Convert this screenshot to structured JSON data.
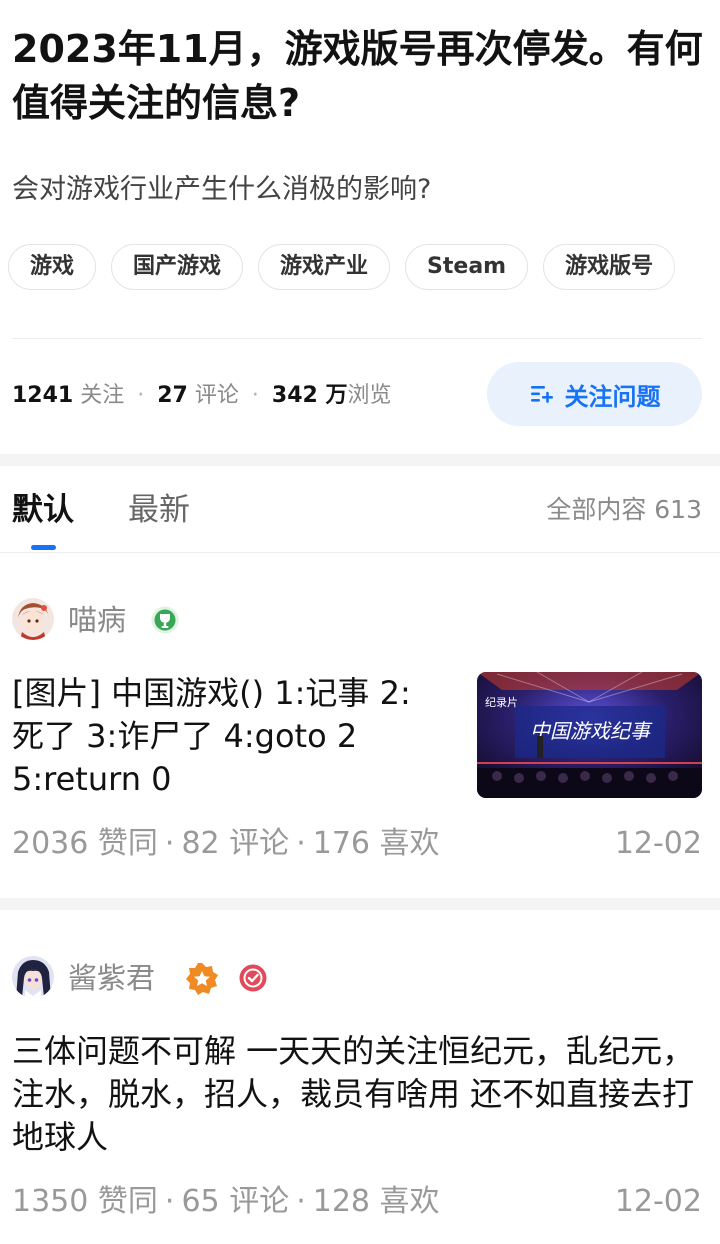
{
  "question": {
    "title": "2023年11月，游戏版号再次停发。有何值得关注的信息?",
    "subtitle": "会对游戏行业产生什么消极的影响?",
    "tags": [
      "游戏",
      "国产游戏",
      "游戏产业",
      "Steam",
      "游戏版号"
    ],
    "stats": {
      "follow_count": "1241",
      "follow_label": "关注",
      "comment_count": "27",
      "comment_label": "评论",
      "view_count": "342 万",
      "view_label": "浏览",
      "separator": "·"
    },
    "follow_button_label": "关注问题"
  },
  "tabs": {
    "default_label": "默认",
    "newest_label": "最新",
    "all_content_label": "全部内容 613"
  },
  "answers": [
    {
      "author": "喵病",
      "text": "[图片] 中国游戏() 1:记事 2:死了 3:诈尸了 4:goto 2 5:return 0",
      "thumbnail_text": "中国游戏纪事",
      "thumbnail_corner": "纪录片",
      "likes": "2036",
      "likes_label": "赞同",
      "comments": "82",
      "comments_label": "评论",
      "favorites": "176",
      "favorites_label": "喜欢",
      "date": "12-02",
      "sep": "·"
    },
    {
      "author": "酱紫君",
      "text": "三体问题不可解 一天天的关注恒纪元，乱纪元，注水，脱水，招人，裁员有啥用 还不如直接去打地球人",
      "likes": "1350",
      "likes_label": "赞同",
      "comments": "65",
      "comments_label": "评论",
      "favorites": "128",
      "favorites_label": "喜欢",
      "date": "12-02",
      "sep": "·"
    }
  ],
  "colors": {
    "accent": "#1772f6",
    "follow_bg": "#e8f1fc",
    "muted_text": "#999999",
    "badge_green": "#3aa757",
    "badge_orange": "#f08a24",
    "badge_red": "#e04a5a"
  },
  "icons": [
    "follow-plus-list-icon",
    "trophy-badge-icon",
    "star-badge-icon",
    "verified-check-badge-icon"
  ]
}
